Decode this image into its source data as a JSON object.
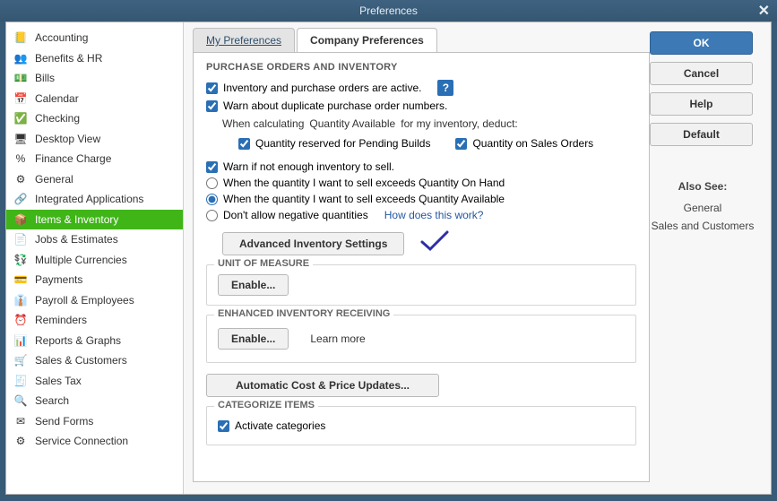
{
  "window": {
    "title": "Preferences"
  },
  "sidebar": {
    "items": [
      {
        "label": "Accounting",
        "icon": "📒"
      },
      {
        "label": "Benefits & HR",
        "icon": "👥"
      },
      {
        "label": "Bills",
        "icon": "💵"
      },
      {
        "label": "Calendar",
        "icon": "📅"
      },
      {
        "label": "Checking",
        "icon": "✅"
      },
      {
        "label": "Desktop View",
        "icon": "🖥"
      },
      {
        "label": "Finance Charge",
        "icon": "%"
      },
      {
        "label": "General",
        "icon": "⚙"
      },
      {
        "label": "Integrated Applications",
        "icon": "🔗"
      },
      {
        "label": "Items & Inventory",
        "icon": "📦"
      },
      {
        "label": "Jobs & Estimates",
        "icon": "📄"
      },
      {
        "label": "Multiple Currencies",
        "icon": "💱"
      },
      {
        "label": "Payments",
        "icon": "💳"
      },
      {
        "label": "Payroll & Employees",
        "icon": "👔"
      },
      {
        "label": "Reminders",
        "icon": "⏰"
      },
      {
        "label": "Reports & Graphs",
        "icon": "📊"
      },
      {
        "label": "Sales & Customers",
        "icon": "🛒"
      },
      {
        "label": "Sales Tax",
        "icon": "🧾"
      },
      {
        "label": "Search",
        "icon": "🔍"
      },
      {
        "label": "Send Forms",
        "icon": "✉"
      },
      {
        "label": "Service Connection",
        "icon": "⚙"
      }
    ],
    "selected_index": 9
  },
  "tabs": {
    "my": "My Preferences",
    "company": "Company Preferences"
  },
  "sections": {
    "po_inv_title": "PURCHASE ORDERS AND INVENTORY",
    "inv_active": "Inventory and purchase orders are active.",
    "warn_dup": "Warn about duplicate purchase order numbers.",
    "when_calc_pre": "When calculating",
    "quantity_available_link": "Quantity Available",
    "when_calc_post": "for my inventory, deduct:",
    "qty_pending": "Quantity reserved for Pending Builds",
    "qty_sales": "Quantity on Sales Orders",
    "warn_not_enough": "Warn if not enough inventory to sell.",
    "radio_onhand": "When the quantity I want to sell exceeds Quantity On Hand",
    "radio_available": "When the quantity I want to sell exceeds Quantity Available",
    "no_negative": "Don't allow negative quantities",
    "how_link": "How does this work?",
    "adv_inv_btn": "Advanced Inventory Settings",
    "uom_title": "UNIT OF MEASURE",
    "enable_btn": "Enable...",
    "eir_title": "ENHANCED INVENTORY RECEIVING",
    "learn_more": "Learn more",
    "auto_cost_btn": "Automatic Cost & Price Updates...",
    "cat_title": "CATEGORIZE ITEMS",
    "activate_cat": "Activate categories"
  },
  "buttons": {
    "ok": "OK",
    "cancel": "Cancel",
    "help": "Help",
    "default": "Default"
  },
  "also_see": {
    "title": "Also See:",
    "items": [
      "General",
      "Sales and Customers"
    ]
  }
}
